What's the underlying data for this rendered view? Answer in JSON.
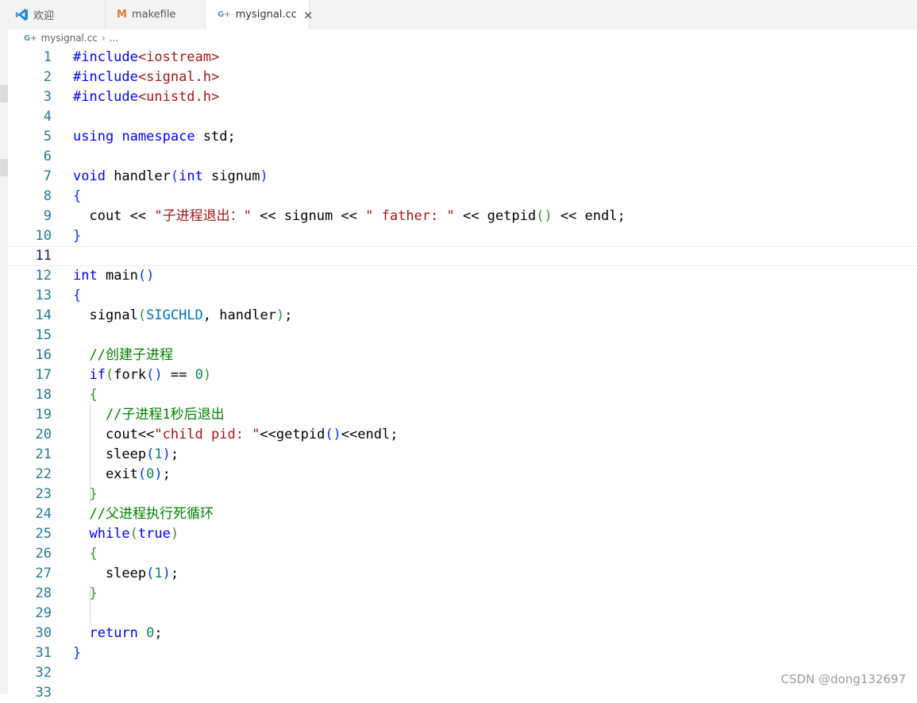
{
  "tabs": [
    {
      "label": "欢迎",
      "icon": "vscode-icon"
    },
    {
      "label": "makefile",
      "icon": "makefile-icon",
      "icon_glyph": "M"
    },
    {
      "label": "mysignal.cc",
      "icon": "cpp-file-icon",
      "icon_glyph": "G+",
      "active": true,
      "close_glyph": "×"
    }
  ],
  "breadcrumb": {
    "file": "mysignal.cc",
    "sep": "›",
    "more": "..."
  },
  "editor": {
    "current_line": 11,
    "lines": [
      [
        [
          "#include",
          "pp"
        ],
        [
          "<iostream>",
          "inc"
        ]
      ],
      [
        [
          "#include",
          "pp"
        ],
        [
          "<signal.h>",
          "inc"
        ]
      ],
      [
        [
          "#include",
          "pp"
        ],
        [
          "<unistd.h>",
          "inc"
        ]
      ],
      [],
      [
        [
          "using",
          "kw"
        ],
        [
          " ",
          ""
        ],
        [
          "namespace",
          "kw"
        ],
        [
          " std;",
          ""
        ]
      ],
      [],
      [
        [
          "void",
          "kw"
        ],
        [
          " handler",
          ""
        ],
        [
          "(",
          "b1"
        ],
        [
          "int",
          "kw"
        ],
        [
          " signum",
          ""
        ],
        [
          ")",
          "b1"
        ]
      ],
      [
        [
          "{",
          "b1"
        ]
      ],
      [
        [
          "  cout << ",
          ""
        ],
        [
          "\"子进程退出：\"",
          "str"
        ],
        [
          " << signum << ",
          ""
        ],
        [
          "\" father: \"",
          "str"
        ],
        [
          " << getpid",
          ""
        ],
        [
          "()",
          "b2"
        ],
        [
          " << endl;",
          ""
        ]
      ],
      [
        [
          "}",
          "b1"
        ]
      ],
      [],
      [
        [
          "int",
          "kw"
        ],
        [
          " main",
          ""
        ],
        [
          "()",
          "b1"
        ]
      ],
      [
        [
          "{",
          "b1"
        ]
      ],
      [
        [
          "  signal",
          ""
        ],
        [
          "(",
          "b2"
        ],
        [
          "SIGCHLD",
          "m"
        ],
        [
          ", handler",
          ""
        ],
        [
          ")",
          "b2"
        ],
        [
          ";",
          ""
        ]
      ],
      [],
      [
        [
          "  ",
          ""
        ],
        [
          "//创建子进程",
          "cm"
        ]
      ],
      [
        [
          "  ",
          ""
        ],
        [
          "if",
          "kw"
        ],
        [
          "(",
          "b2"
        ],
        [
          "fork",
          ""
        ],
        [
          "()",
          "b1"
        ],
        [
          " == ",
          ""
        ],
        [
          "0",
          "num"
        ],
        [
          ")",
          "b2"
        ]
      ],
      [
        [
          "  ",
          ""
        ],
        [
          "{",
          "b2"
        ]
      ],
      [
        [
          "    ",
          ""
        ],
        [
          "//子进程1秒后退出",
          "cm"
        ]
      ],
      [
        [
          "    cout<<",
          ""
        ],
        [
          "\"child pid: \"",
          "str"
        ],
        [
          "<<getpid",
          ""
        ],
        [
          "()",
          "b1"
        ],
        [
          "<<endl;",
          ""
        ]
      ],
      [
        [
          "    sleep",
          ""
        ],
        [
          "(",
          "b1"
        ],
        [
          "1",
          "num"
        ],
        [
          ")",
          "b1"
        ],
        [
          ";",
          ""
        ]
      ],
      [
        [
          "    exit",
          ""
        ],
        [
          "(",
          "b1"
        ],
        [
          "0",
          "num"
        ],
        [
          ")",
          "b1"
        ],
        [
          ";",
          ""
        ]
      ],
      [
        [
          "  ",
          ""
        ],
        [
          "}",
          "b2"
        ]
      ],
      [
        [
          "  ",
          ""
        ],
        [
          "//父进程执行死循环",
          "cm"
        ]
      ],
      [
        [
          "  ",
          ""
        ],
        [
          "while",
          "kw"
        ],
        [
          "(",
          "b2"
        ],
        [
          "true",
          "kw"
        ],
        [
          ")",
          "b2"
        ]
      ],
      [
        [
          "  ",
          ""
        ],
        [
          "{",
          "b2"
        ]
      ],
      [
        [
          "    sleep",
          ""
        ],
        [
          "(",
          "b1"
        ],
        [
          "1",
          "num"
        ],
        [
          ")",
          "b1"
        ],
        [
          ";",
          ""
        ]
      ],
      [
        [
          "  ",
          ""
        ],
        [
          "}",
          "b2"
        ]
      ],
      [],
      [
        [
          "  ",
          ""
        ],
        [
          "return",
          "kw"
        ],
        [
          " ",
          ""
        ],
        [
          "0",
          "num"
        ],
        [
          ";",
          ""
        ]
      ],
      [
        [
          "}",
          "b1"
        ]
      ],
      [],
      []
    ]
  },
  "watermark": "CSDN @dong132697",
  "colors": {
    "keyword": "#0000ff",
    "string": "#a31515",
    "number": "#098658",
    "comment": "#008000",
    "macro": "#0070c1",
    "line_number": "#237893",
    "bracket_level1": "#0431fa",
    "bracket_level2": "#319331"
  }
}
